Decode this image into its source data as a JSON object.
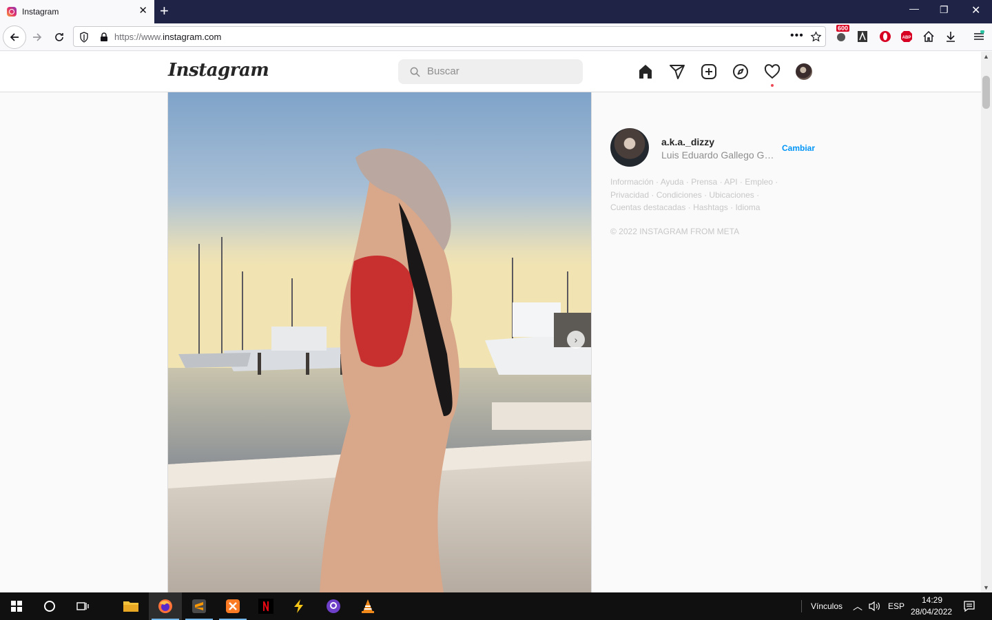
{
  "browser": {
    "tab_title": "Instagram",
    "url_prefix": "https://www.",
    "url_domain": "instagram.com",
    "badge_count": "600"
  },
  "instagram": {
    "logo_text": "Instagram",
    "search_placeholder": "Buscar",
    "nav_icons": [
      "home-icon",
      "direct-icon",
      "new-post-icon",
      "explore-icon",
      "activity-icon",
      "profile-avatar"
    ]
  },
  "sidebar": {
    "username": "a.k.a._dizzy",
    "full_name": "Luis Eduardo Gallego Gar...",
    "switch_label": "Cambiar",
    "footer_links": [
      "Información",
      "Ayuda",
      "Prensa",
      "API",
      "Empleo",
      "Privacidad",
      "Condiciones",
      "Ubicaciones",
      "Cuentas destacadas",
      "Hashtags",
      "Idioma"
    ],
    "copyright": "© 2022 INSTAGRAM FROM META"
  },
  "taskbar": {
    "links_label": "Vínculos",
    "language": "ESP",
    "time": "14:29",
    "date": "28/04/2022"
  },
  "colors": {
    "accent_blue": "#0095f6",
    "tabbar_bg": "#1f2447",
    "notif_red": "#ed4956"
  }
}
